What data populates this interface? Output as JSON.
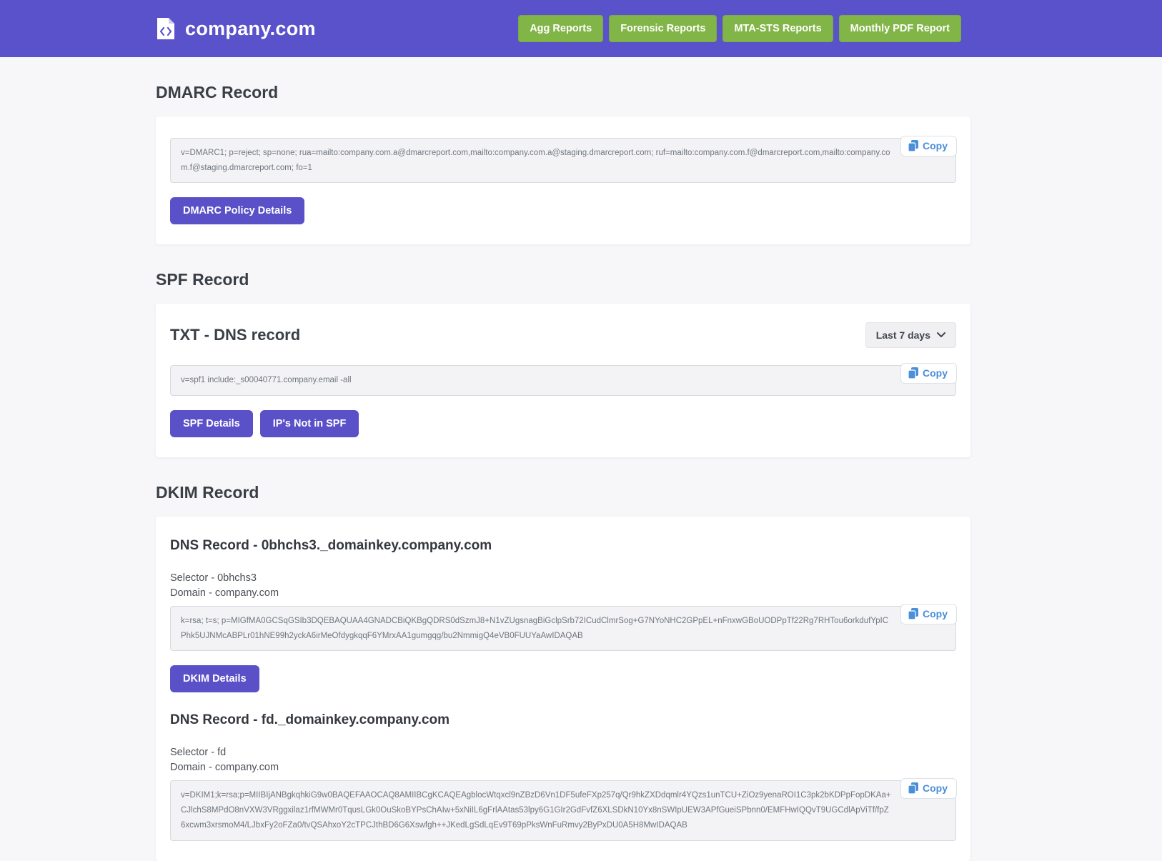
{
  "header": {
    "brand": "company.com",
    "nav": [
      {
        "label": "Agg Reports"
      },
      {
        "label": "Forensic Reports"
      },
      {
        "label": "MTA-STS Reports"
      },
      {
        "label": "Monthly PDF Report"
      }
    ]
  },
  "colors": {
    "header_bg": "#5a52cb",
    "nav_button_green": "#82b548",
    "primary_button_purple": "#5a50c8",
    "copy_blue": "#4a8fd9",
    "record_box_bg": "#f3f3f5"
  },
  "icons": {
    "brand": "file-code-icon",
    "copy": "clipboard-icon",
    "dropdown": "chevron-down-icon"
  },
  "dmarc": {
    "title": "DMARC Record",
    "record": "v=DMARC1; p=reject; sp=none; rua=mailto:company.com.a@dmarcreport.com,mailto:company.com.a@staging.dmarcreport.com; ruf=mailto:company.com.f@dmarcreport.com,mailto:company.com.f@staging.dmarcreport.com; fo=1",
    "copy_label": "Copy",
    "details_button": "DMARC Policy Details"
  },
  "spf": {
    "title": "SPF Record",
    "card_title": "TXT - DNS record",
    "period_selector": "Last 7 days",
    "record": "v=spf1 include:_s00040771.company.email -all",
    "copy_label": "Copy",
    "buttons": [
      {
        "label": "SPF Details"
      },
      {
        "label": "IP's Not in SPF"
      }
    ]
  },
  "dkim": {
    "title": "DKIM Record",
    "records": [
      {
        "heading": "DNS Record - 0bhchs3._domainkey.company.com",
        "selector": "Selector - 0bhchs3",
        "domain": "Domain - company.com",
        "record": "k=rsa; t=s; p=MIGfMA0GCSqGSIb3DQEBAQUAA4GNADCBiQKBgQDRS0dSzmJ8+N1vZUgsnagBiGclpSrb72ICudClmrSog+G7NYoNHC2GPpEL+nFnxwGBoUODPpTf22Rg7RHTou6orkdufYpICPhk5UJNMcABPLr01hNE99h2yckA6irMeOfdygkqqF6YMrxAA1gumgqg/bu2NmmigQ4eVB0FUUYaAwIDAQAB",
        "copy_label": "Copy",
        "details_button": "DKIM Details"
      },
      {
        "heading": "DNS Record - fd._domainkey.company.com",
        "selector": "Selector - fd",
        "domain": "Domain - company.com",
        "record": "v=DKIM1;k=rsa;p=MIIBIjANBgkqhkiG9w0BAQEFAAOCAQ8AMIIBCgKCAQEAgblocWtqxcl9nZBzD6Vn1DF5ufeFXp257q/Qr9hkZXDdqmlr4YQzs1unTCU+ZiOz9yenaROI1C3pk2bKDPpFopDKAa+CJlchS8MPdO8nVXW3VRggxilaz1rfMWMr0TqusLGk0OuSkoBYPsChAIw+5xNiIL6gFrlAAtas53lpy6G1GIr2GdFvfZ6XLSDkN10Yx8nSWIpUEW3APfGueiSPbnn0/EMFHwIQQvT9UGCdlApViTf/fpZ6xcwm3xrsmoM4/LJbxFy2oFZa0/tvQSAhxoY2cTPCJthBD6G6Xswfgh++JKedLgSdLqEv9T69pPksWnFuRmvy2ByPxDU0A5H8MwIDAQAB",
        "copy_label": "Copy"
      }
    ]
  }
}
